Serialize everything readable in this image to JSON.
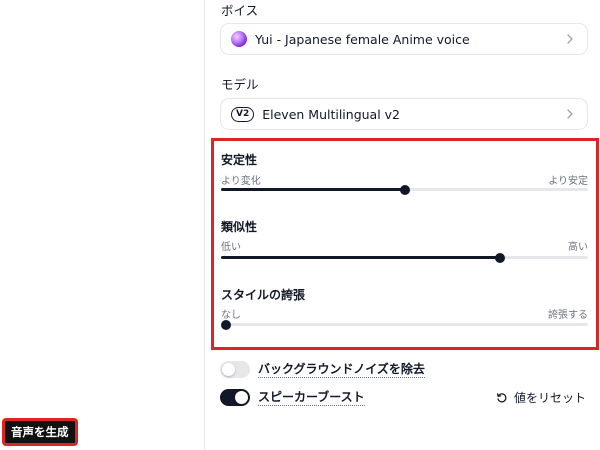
{
  "voice": {
    "label": "ボイス",
    "selected": "Yui - Japanese female Anime voice",
    "icon": "voice-avatar-orb"
  },
  "model": {
    "label": "モデル",
    "badge": "V2",
    "selected": "Eleven Multilingual v2"
  },
  "sliders": [
    {
      "title": "安定性",
      "min_label": "より変化",
      "max_label": "より安定",
      "value": 0.5
    },
    {
      "title": "類似性",
      "min_label": "低い",
      "max_label": "高い",
      "value": 0.76
    },
    {
      "title": "スタイルの誇張",
      "min_label": "なし",
      "max_label": "誇張する",
      "value": 0.0
    }
  ],
  "toggles": [
    {
      "label": "バックグラウンドノイズを除去",
      "on": false
    },
    {
      "label": "スピーカーブースト",
      "on": true
    }
  ],
  "reset_label": "値をリセット",
  "generate_label": "音声を生成",
  "colors": {
    "highlight": "#dc2626",
    "accent": "#111827",
    "track": "#e5e7eb"
  }
}
